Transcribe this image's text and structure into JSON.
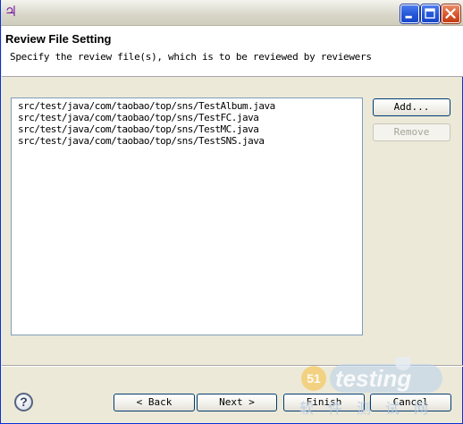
{
  "window": {
    "app_icon": "eclipse-purple-icon",
    "controls": [
      "minimize-icon",
      "maximize-icon",
      "close-icon"
    ]
  },
  "header": {
    "title": "Review File Setting",
    "description": "Specify the review file(s), which is to be reviewed by reviewers"
  },
  "files": [
    "src/test/java/com/taobao/top/sns/TestAlbum.java",
    "src/test/java/com/taobao/top/sns/TestFC.java",
    "src/test/java/com/taobao/top/sns/TestMC.java",
    "src/test/java/com/taobao/top/sns/TestSNS.java"
  ],
  "side_buttons": {
    "add_label": "Add...",
    "remove_label": "Remove"
  },
  "footer": {
    "help_icon": "help-icon",
    "back_label": "< Back",
    "next_label": "Next >",
    "finish_label": "Finish",
    "cancel_label": "Cancel"
  },
  "watermark": {
    "number": "51",
    "brand": "testing",
    "subtitle": "软件测试网"
  },
  "colors": {
    "dialog_bg": "#ece9d8",
    "header_bg": "#ffffff",
    "button_border": "#003c74"
  }
}
